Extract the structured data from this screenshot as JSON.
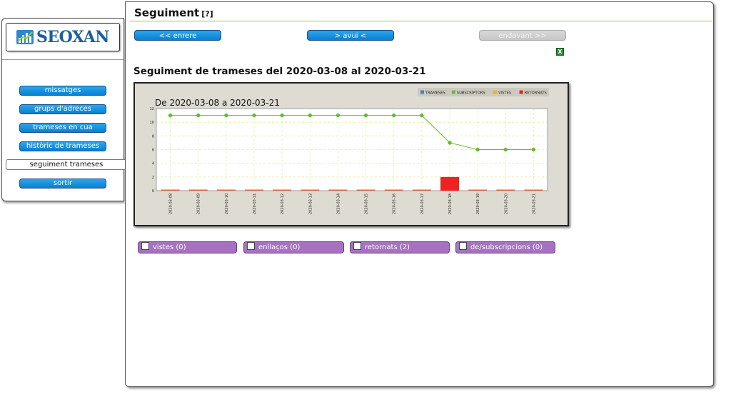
{
  "page": {
    "title": "Seguiment",
    "help": "[?]"
  },
  "nav": {
    "prev": "<< enrere",
    "today": "> avui <",
    "next": "endavant >>"
  },
  "export_icon": "excel-icon",
  "section_title": "Seguiment de trameses del 2020-03-08 al 2020-03-21",
  "chart_data": {
    "type": "bar",
    "title": "De 2020-03-08 a 2020-03-21",
    "categories": [
      "2020-03-08",
      "2020-03-09",
      "2020-03-10",
      "2020-03-11",
      "2020-03-12",
      "2020-03-13",
      "2020-03-14",
      "2020-03-15",
      "2020-03-16",
      "2020-03-17",
      "2020-03-18",
      "2020-03-19",
      "2020-03-20",
      "2020-03-21"
    ],
    "ylim": [
      0,
      12
    ],
    "yticks": [
      "0",
      "2",
      "4",
      "6",
      "8",
      "10",
      "12"
    ],
    "grid": true,
    "legend_position": "top-right",
    "series": [
      {
        "name": "TRAMESES",
        "kind": "bar",
        "color": "#4a7fc0",
        "values": [
          0,
          0,
          0,
          0,
          0,
          0,
          0,
          0,
          0,
          0,
          0,
          0,
          0,
          0
        ]
      },
      {
        "name": "SUBSCRIPTORS",
        "kind": "line",
        "color": "#66bb33",
        "values": [
          11,
          11,
          11,
          11,
          11,
          11,
          11,
          11,
          11,
          11,
          7,
          6,
          6,
          6
        ]
      },
      {
        "name": "VISTES",
        "kind": "bar",
        "color": "#f0b030",
        "values": [
          0,
          0,
          0,
          0,
          0,
          0,
          0,
          0,
          0,
          0,
          0,
          0,
          0,
          0
        ]
      },
      {
        "name": "RETORNATS",
        "kind": "bar",
        "color": "#ee2222",
        "values": [
          0,
          0,
          0,
          0,
          0,
          0,
          0,
          0,
          0,
          0,
          2,
          0,
          0,
          0
        ]
      }
    ]
  },
  "filters": [
    {
      "label": "vistes (0)"
    },
    {
      "label": "enllaços (0)"
    },
    {
      "label": "retornats (2)"
    },
    {
      "label": "de/subscripcions (0)"
    }
  ],
  "sidebar": {
    "logo": "SEOXAN",
    "items": [
      {
        "label": "missatges"
      },
      {
        "label": "grups d'adreces"
      },
      {
        "label": "trameses en cua"
      },
      {
        "label": "històric de trameses"
      },
      {
        "label": "seguiment trameses",
        "active": true
      },
      {
        "label": "sortir"
      }
    ]
  }
}
